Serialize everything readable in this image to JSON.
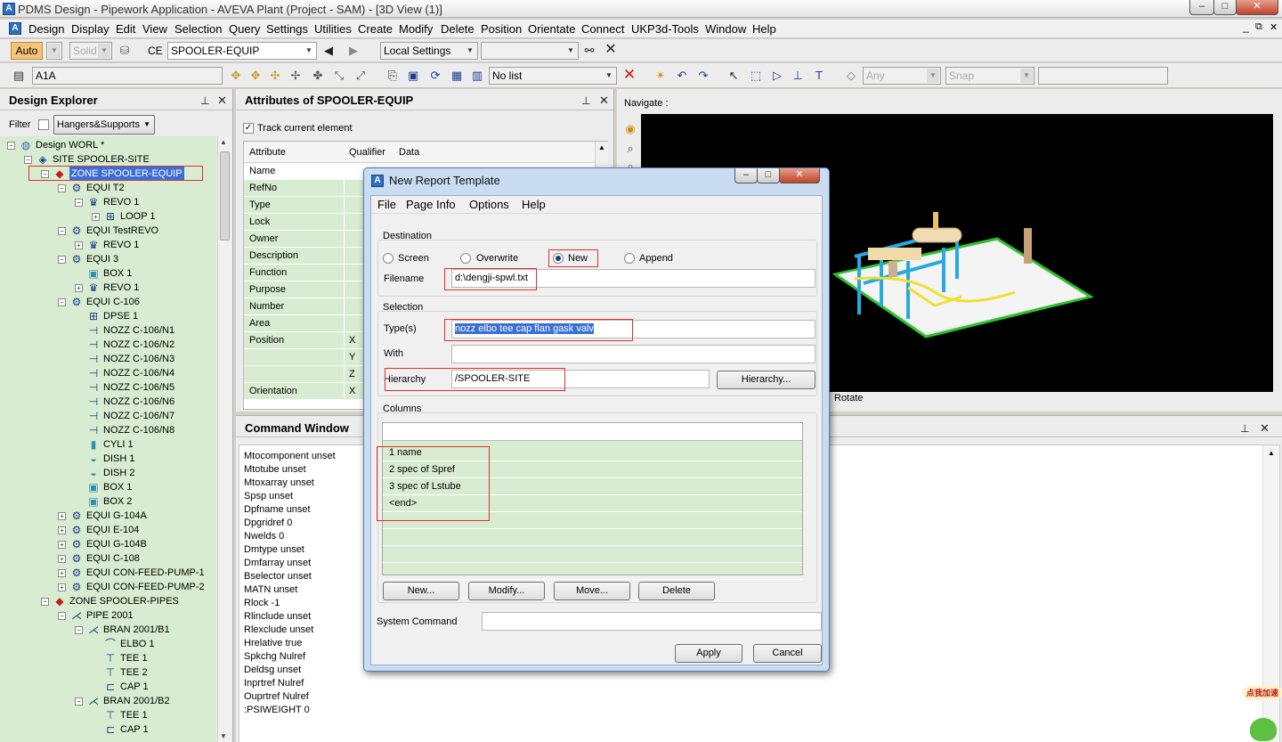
{
  "app": {
    "title": "PDMS Design - Pipework Application -  AVEVA Plant (Project - SAM) - [3D View (1)]",
    "icon_letter": "A"
  },
  "window_controls": {
    "min": "–",
    "max": "□",
    "close": "✕",
    "inner_min": "_",
    "inner_max": "⧉",
    "inner_close": "✕"
  },
  "menu": [
    "Design",
    "Display",
    "Edit",
    "View",
    "Selection",
    "Query",
    "Settings",
    "Utilities",
    "Create",
    "Modify",
    "Delete",
    "Position",
    "Orientate",
    "Connect",
    "UKP3d-Tools",
    "Window",
    "Help"
  ],
  "toolbar1": {
    "auto": "Auto",
    "solid": "Solid",
    "ce_label": "CE",
    "ce_value": "SPOOLER-EQUIP",
    "local_settings": "Local Settings"
  },
  "toolbar2": {
    "ref_value": "A1A",
    "list_value": "No list",
    "any": "Any",
    "snap": "Snap"
  },
  "design_explorer": {
    "title": "Design Explorer",
    "filter_label": "Filter",
    "filter_value": "Hangers&Supports",
    "tree": [
      {
        "text": "Design WORL *",
        "icon": "globe-icon",
        "exp": "-"
      },
      {
        "text": "SITE SPOOLER-SITE",
        "icon": "site-icon",
        "exp": "-"
      },
      {
        "text": "ZONE SPOOLER-EQUIP",
        "icon": "zone-icon",
        "exp": "-",
        "selected": true
      },
      {
        "text": "EQUI T2",
        "icon": "equi-icon",
        "exp": "-"
      },
      {
        "text": "REVO 1",
        "icon": "revo-icon",
        "exp": "-"
      },
      {
        "text": "LOOP 1",
        "icon": "loop-icon",
        "exp": "+"
      },
      {
        "text": "EQUI TestREVO",
        "icon": "equi-icon",
        "exp": "-"
      },
      {
        "text": "REVO 1",
        "icon": "revo-icon",
        "exp": "+"
      },
      {
        "text": "EQUI 3",
        "icon": "equi-icon",
        "exp": "-"
      },
      {
        "text": "BOX 1",
        "icon": "box-icon",
        "exp": ""
      },
      {
        "text": "REVO 1",
        "icon": "revo-icon",
        "exp": "+"
      },
      {
        "text": "EQUI C-106",
        "icon": "equi-icon",
        "exp": "-"
      },
      {
        "text": "DPSE 1",
        "icon": "dpse-icon",
        "exp": ""
      },
      {
        "text": "NOZZ C-106/N1",
        "icon": "nozz-icon",
        "exp": ""
      },
      {
        "text": "NOZZ C-106/N2",
        "icon": "nozz-icon",
        "exp": ""
      },
      {
        "text": "NOZZ C-106/N3",
        "icon": "nozz-icon",
        "exp": ""
      },
      {
        "text": "NOZZ C-106/N4",
        "icon": "nozz-icon",
        "exp": ""
      },
      {
        "text": "NOZZ C-106/N5",
        "icon": "nozz-icon",
        "exp": ""
      },
      {
        "text": "NOZZ C-106/N6",
        "icon": "nozz-icon",
        "exp": ""
      },
      {
        "text": "NOZZ C-106/N7",
        "icon": "nozz-icon",
        "exp": ""
      },
      {
        "text": "NOZZ C-106/N8",
        "icon": "nozz-icon",
        "exp": ""
      },
      {
        "text": "CYLI 1",
        "icon": "cyli-icon",
        "exp": ""
      },
      {
        "text": "DISH 1",
        "icon": "dish-icon",
        "exp": ""
      },
      {
        "text": "DISH 2",
        "icon": "dish-icon",
        "exp": ""
      },
      {
        "text": "BOX 1",
        "icon": "box-icon",
        "exp": ""
      },
      {
        "text": "BOX 2",
        "icon": "box-icon",
        "exp": ""
      },
      {
        "text": "EQUI G-104A",
        "icon": "equi-icon",
        "exp": "+"
      },
      {
        "text": "EQUI E-104",
        "icon": "equi-icon",
        "exp": "+"
      },
      {
        "text": "EQUI G-104B",
        "icon": "equi-icon",
        "exp": "+"
      },
      {
        "text": "EQUI C-108",
        "icon": "equi-icon",
        "exp": "+"
      },
      {
        "text": "EQUI CON-FEED-PUMP-1",
        "icon": "equi-icon",
        "exp": "+"
      },
      {
        "text": "EQUI CON-FEED-PUMP-2",
        "icon": "equi-icon",
        "exp": "+"
      },
      {
        "text": "ZONE SPOOLER-PIPES",
        "icon": "zone-icon",
        "exp": "-"
      },
      {
        "text": "PIPE 2001",
        "icon": "pipe-icon",
        "exp": "-"
      },
      {
        "text": "BRAN 2001/B1",
        "icon": "bran-icon",
        "exp": "-"
      },
      {
        "text": "ELBO 1",
        "icon": "elbo-icon",
        "exp": ""
      },
      {
        "text": "TEE 1",
        "icon": "tee-icon",
        "exp": ""
      },
      {
        "text": "TEE 2",
        "icon": "tee-icon",
        "exp": ""
      },
      {
        "text": "CAP 1",
        "icon": "cap-icon",
        "exp": ""
      },
      {
        "text": "BRAN 2001/B2",
        "icon": "bran-icon",
        "exp": "-"
      },
      {
        "text": "TEE 1",
        "icon": "tee-icon",
        "exp": ""
      },
      {
        "text": "CAP 1",
        "icon": "cap-icon",
        "exp": ""
      }
    ]
  },
  "attributes": {
    "title": "Attributes of SPOOLER-EQUIP",
    "track_label": "Track current element",
    "headers": [
      "Attribute",
      "Qualifier",
      "Data"
    ],
    "rows": [
      {
        "name": "Name",
        "q": ""
      },
      {
        "name": "RefNo",
        "q": ""
      },
      {
        "name": "Type",
        "q": ""
      },
      {
        "name": "Lock",
        "q": ""
      },
      {
        "name": "Owner",
        "q": ""
      },
      {
        "name": "Description",
        "q": ""
      },
      {
        "name": "Function",
        "q": ""
      },
      {
        "name": "Purpose",
        "q": ""
      },
      {
        "name": "Number",
        "q": ""
      },
      {
        "name": "Area",
        "q": ""
      },
      {
        "name": "Position",
        "q": "X"
      },
      {
        "name": "",
        "q": "Y"
      },
      {
        "name": "",
        "q": "Z"
      },
      {
        "name": "Orientation",
        "q": "X"
      }
    ]
  },
  "view3d": {
    "navigate": "Navigate :",
    "rotate": "Rotate"
  },
  "command_window": {
    "title": "Command Window",
    "lines": [
      "Mtocomponent unset",
      "Mtotube unset",
      "Mtoxarray unset",
      "Spsp unset",
      "Dpfname unset",
      "Dpgridref 0",
      "Nwelds 0",
      "Dmtype unset",
      "Dmfarray unset",
      "Bselector unset",
      "MATN unset",
      "Rlock -1",
      "Rlinclude unset",
      "Rlexclude unset",
      "Hrelative true",
      "Spkchg Nulref",
      "Deldsg unset",
      "Inprtref Nulref",
      "Ouprtref Nulref",
      ":PSIWEIGHT 0"
    ]
  },
  "dialog": {
    "title": "New Report Template",
    "menu": [
      "File",
      "Page Info",
      "Options",
      "Help"
    ],
    "destination_label": "Destination",
    "radios": [
      "Screen",
      "Overwrite",
      "New",
      "Append"
    ],
    "filename_label": "Filename",
    "filename_value": "d:\\dengji-spwl.txt",
    "selection_label": "Selection",
    "types_label": "Type(s)",
    "types_value": "nozz elbo tee cap flan gask valv",
    "with_label": "With",
    "with_value": "",
    "hierarchy_label": "Hierarchy",
    "hierarchy_value": "/SPOOLER-SITE",
    "hierarchy_button": "Hierarchy...",
    "columns_label": "Columns",
    "columns": [
      "1 name",
      "2 spec of Spref",
      "3 spec of Lstube",
      "<end>"
    ],
    "btn_new": "New...",
    "btn_modify": "Modify...",
    "btn_move": "Move...",
    "btn_delete": "Delete",
    "system_command_label": "System Command",
    "system_command_value": "",
    "apply": "Apply",
    "cancel": "Cancel"
  },
  "corner_badge": "点我加速",
  "colors": {
    "tree_bg": "#d7ecd0",
    "selection": "#3a6fd8",
    "highlight_box": "#e03030",
    "viewport_bg": "#000000"
  }
}
